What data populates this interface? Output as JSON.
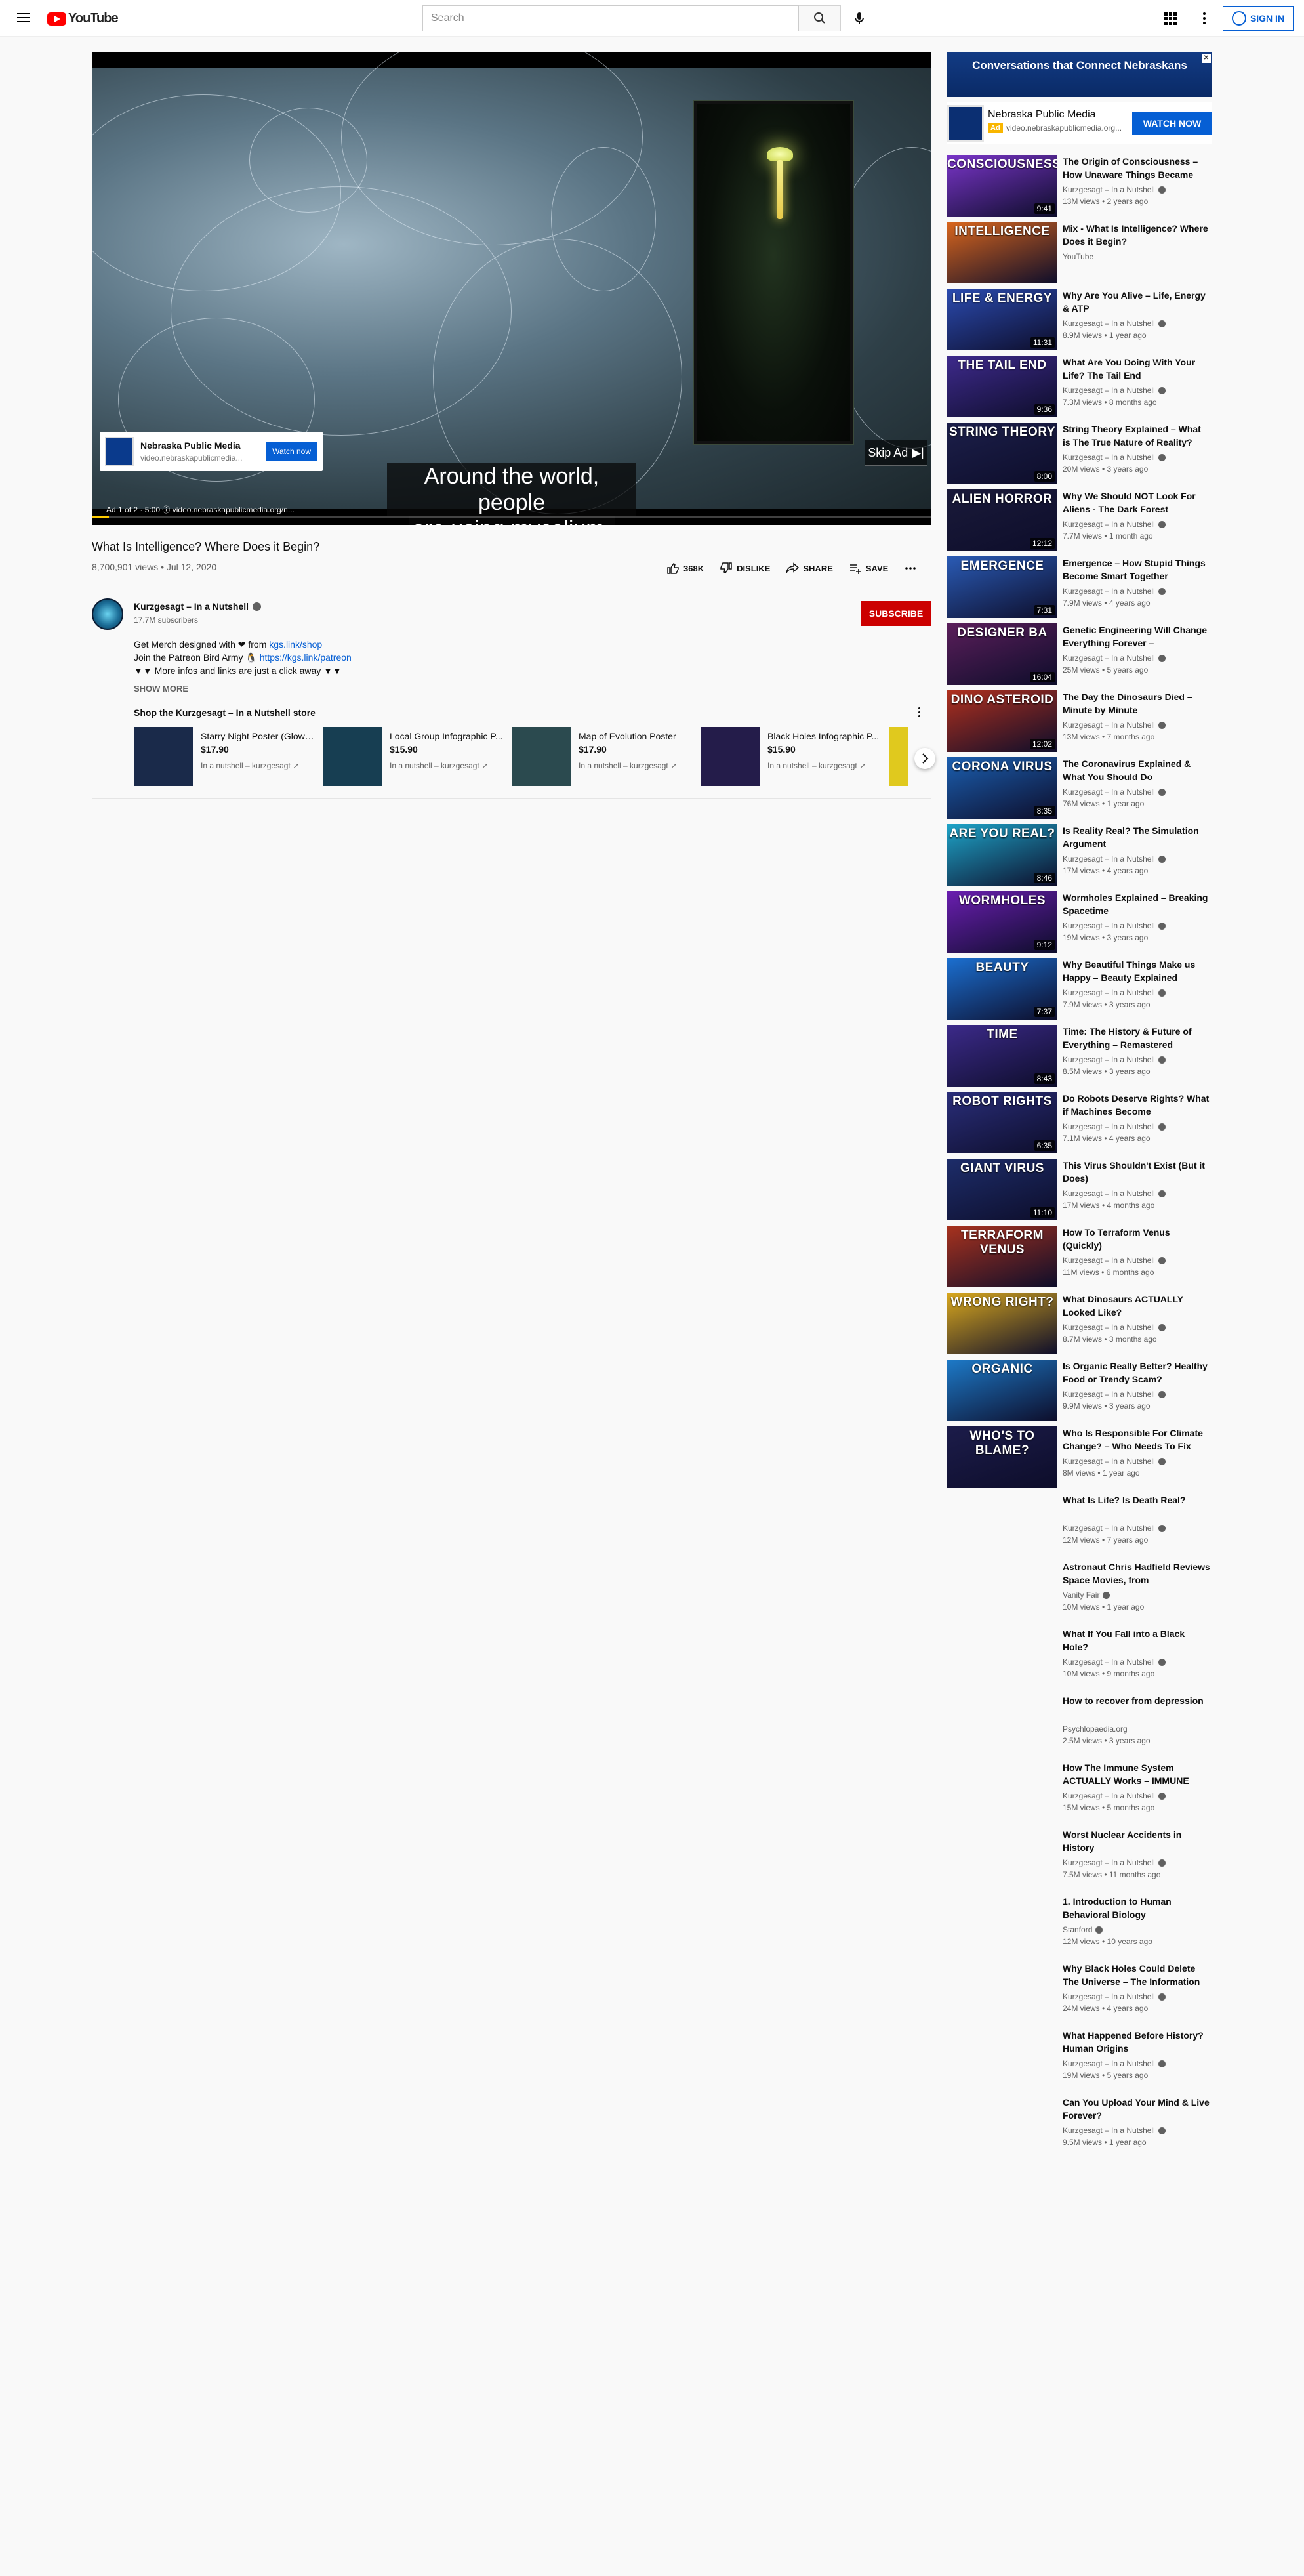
{
  "header": {
    "logo_text": "YouTube",
    "search_placeholder": "Search",
    "signin_label": "SIGN IN"
  },
  "player": {
    "subtitle_line1": "Around the world, people",
    "subtitle_line2": "are using mycelium,",
    "ad_card": {
      "name": "Nebraska Public Media",
      "url": "video.nebraskapublicmedia...",
      "button": "Watch now"
    },
    "skip_label": "Skip Ad",
    "ad_info": "Ad 1 of 2 · 5:00  ⓘ  video.nebraskapublicmedia.org/n...",
    "ad_progress": 0.02
  },
  "video": {
    "title": "What Is Intelligence? Where Does it Begin?",
    "meta": "8,700,901 views • Jul 12, 2020",
    "likes": "368K",
    "dislike_label": "DISLIKE",
    "share_label": "SHARE",
    "save_label": "SAVE"
  },
  "channel": {
    "name": "Kurzgesagt – In a Nutshell",
    "subscribers": "17.7M subscribers",
    "subscribe_label": "SUBSCRIBE"
  },
  "description": {
    "line1_text": "Get Merch designed with ❤ from ",
    "line1_link": "kgs.link/shop",
    "line2_text": "Join the Patreon Bird Army 🐧 ",
    "line2_link": "https://kgs.link/patreon",
    "line3_text": "▼▼ More infos and links are just a click away ▼▼",
    "show_more": "SHOW MORE"
  },
  "shop": {
    "title": "Shop the Kurzgesagt – In a Nutshell store",
    "products": [
      {
        "name": "Starry Night Poster (Glow i...",
        "price": "$17.90",
        "seller": "In a nutshell – kurzgesagt",
        "color": "#1a2a4a"
      },
      {
        "name": "Local Group Infographic P...",
        "price": "$15.90",
        "seller": "In a nutshell – kurzgesagt",
        "color": "#173e52"
      },
      {
        "name": "Map of Evolution Poster",
        "price": "$17.90",
        "seller": "In a nutshell – kurzgesagt",
        "color": "#2b4a4f"
      },
      {
        "name": "Black Holes Infographic P...",
        "price": "$15.90",
        "seller": "In a nutshell – kurzgesagt",
        "color": "#241c4a"
      }
    ]
  },
  "sidebar": {
    "ad_banner": "Conversations that Connect Nebraskans",
    "ad_name": "Nebraska Public Media",
    "ad_badge": "Ad",
    "ad_url": "video.nebraskapublicmedia.org...",
    "ad_button": "WATCH NOW",
    "recommendations": [
      {
        "title": "The Origin of Consciousness – How Unaware Things Became",
        "channel": "Kurzgesagt – In a Nutshell",
        "views": "13M views • 2 years ago",
        "thumb_text": "CONSCIOUSNESS",
        "duration": "9:41",
        "color": "#7a35c9",
        "verified": true
      },
      {
        "title": "Mix - What Is Intelligence? Where Does it Begin?",
        "channel": "YouTube",
        "views": "",
        "thumb_text": "INTELLIGENCE",
        "duration": "",
        "color": "#d9661d",
        "verified": false
      },
      {
        "title": "Why Are You Alive – Life, Energy & ATP",
        "channel": "Kurzgesagt – In a Nutshell",
        "views": "8.9M views • 1 year ago",
        "thumb_text": "LIFE & ENERGY",
        "duration": "11:31",
        "color": "#2b4bb0",
        "verified": true
      },
      {
        "title": "What Are You Doing With Your Life? The Tail End",
        "channel": "Kurzgesagt – In a Nutshell",
        "views": "7.3M views • 8 months ago",
        "thumb_text": "THE TAIL END",
        "duration": "9:36",
        "color": "#3e2a8c",
        "verified": true
      },
      {
        "title": "String Theory Explained – What is The True Nature of Reality?",
        "channel": "Kurzgesagt – In a Nutshell",
        "views": "20M views • 3 years ago",
        "thumb_text": "STRING THEORY",
        "duration": "8:00",
        "color": "#1c1f4a",
        "verified": true
      },
      {
        "title": "Why We Should NOT Look For Aliens - The Dark Forest",
        "channel": "Kurzgesagt – In a Nutshell",
        "views": "7.7M views • 1 month ago",
        "thumb_text": "ALIEN HORROR",
        "duration": "12:12",
        "color": "#1a1a3a",
        "verified": true
      },
      {
        "title": "Emergence – How Stupid Things Become Smart Together",
        "channel": "Kurzgesagt – In a Nutshell",
        "views": "7.9M views • 4 years ago",
        "thumb_text": "EMERGENCE",
        "duration": "7:31",
        "color": "#2a5bb5",
        "verified": true
      },
      {
        "title": "Genetic Engineering Will Change Everything Forever –",
        "channel": "Kurzgesagt – In a Nutshell",
        "views": "25M views • 5 years ago",
        "thumb_text": "DESIGNER BA",
        "duration": "16:04",
        "color": "#5a1e5a",
        "verified": true
      },
      {
        "title": "The Day the Dinosaurs Died – Minute by Minute",
        "channel": "Kurzgesagt – In a Nutshell",
        "views": "13M views • 7 months ago",
        "thumb_text": "DINO ASTEROID",
        "duration": "12:02",
        "color": "#b0301e",
        "verified": true
      },
      {
        "title": "The Coronavirus Explained & What You Should Do",
        "channel": "Kurzgesagt – In a Nutshell",
        "views": "76M views • 1 year ago",
        "thumb_text": "CORONA VIRUS",
        "duration": "8:35",
        "color": "#1b5fb0",
        "verified": true
      },
      {
        "title": "Is Reality Real? The Simulation Argument",
        "channel": "Kurzgesagt – In a Nutshell",
        "views": "17M views • 4 years ago",
        "thumb_text": "ARE YOU REAL?",
        "duration": "8:46",
        "color": "#1ea4c8",
        "verified": true
      },
      {
        "title": "Wormholes Explained – Breaking Spacetime",
        "channel": "Kurzgesagt – In a Nutshell",
        "views": "19M views • 3 years ago",
        "thumb_text": "WORMHOLES",
        "duration": "9:12",
        "color": "#6a1eb0",
        "verified": true
      },
      {
        "title": "Why Beautiful Things Make us Happy – Beauty Explained",
        "channel": "Kurzgesagt – In a Nutshell",
        "views": "7.9M views • 3 years ago",
        "thumb_text": "BEAUTY",
        "duration": "7:37",
        "color": "#1b6fd0",
        "verified": true
      },
      {
        "title": "Time: The History & Future of Everything – Remastered",
        "channel": "Kurzgesagt – In a Nutshell",
        "views": "8.5M views • 3 years ago",
        "thumb_text": "TIME",
        "duration": "8:43",
        "color": "#3c2a8a",
        "verified": true
      },
      {
        "title": "Do Robots Deserve Rights? What if Machines Become",
        "channel": "Kurzgesagt – In a Nutshell",
        "views": "7.1M views • 4 years ago",
        "thumb_text": "ROBOT RIGHTS",
        "duration": "6:35",
        "color": "#2a2e7a",
        "verified": true
      },
      {
        "title": "This Virus Shouldn't Exist (But it Does)",
        "channel": "Kurzgesagt – In a Nutshell",
        "views": "17M views • 4 months ago",
        "thumb_text": "GIANT VIRUS",
        "duration": "11:10",
        "color": "#1d2d6a",
        "verified": true
      },
      {
        "title": "How To Terraform Venus (Quickly)",
        "channel": "Kurzgesagt – In a Nutshell",
        "views": "11M views • 6 months ago",
        "thumb_text": "TERRAFORM VENUS",
        "duration": "",
        "color": "#a8321e",
        "verified": true
      },
      {
        "title": "What Dinosaurs ACTUALLY Looked Like?",
        "channel": "Kurzgesagt – In a Nutshell",
        "views": "8.7M views • 3 months ago",
        "thumb_text": "WRONG  RIGHT?",
        "duration": "",
        "color": "#d9a81e",
        "verified": true
      },
      {
        "title": "Is Organic Really Better? Healthy Food or Trendy Scam?",
        "channel": "Kurzgesagt – In a Nutshell",
        "views": "9.9M views • 3 years ago",
        "thumb_text": "ORGANIC",
        "duration": "",
        "color": "#1d7ac8",
        "verified": true
      },
      {
        "title": "Who Is Responsible For Climate Change? – Who Needs To Fix",
        "channel": "Kurzgesagt – In a Nutshell",
        "views": "8M views • 1 year ago",
        "thumb_text": "WHO'S TO BLAME?",
        "duration": "",
        "color": "#1c1c4a",
        "verified": true
      },
      {
        "title": "What Is Life? Is Death Real?",
        "channel": "Kurzgesagt – In a Nutshell",
        "views": "12M views • 7 years ago",
        "thumb_text": "",
        "duration": "",
        "color": "",
        "verified": true
      },
      {
        "title": "Astronaut Chris Hadfield Reviews Space Movies, from",
        "channel": "Vanity Fair",
        "views": "10M views • 1 year ago",
        "thumb_text": "",
        "duration": "",
        "color": "",
        "verified": true
      },
      {
        "title": "What If You Fall into a Black Hole?",
        "channel": "Kurzgesagt – In a Nutshell",
        "views": "10M views • 9 months ago",
        "thumb_text": "",
        "duration": "",
        "color": "",
        "verified": true
      },
      {
        "title": "How to recover from depression",
        "channel": "Psychlopaedia.org",
        "views": "2.5M views • 3 years ago",
        "thumb_text": "",
        "duration": "",
        "color": "",
        "verified": false
      },
      {
        "title": "How The Immune System ACTUALLY Works – IMMUNE",
        "channel": "Kurzgesagt – In a Nutshell",
        "views": "15M views • 5 months ago",
        "thumb_text": "",
        "duration": "",
        "color": "",
        "verified": true
      },
      {
        "title": "Worst Nuclear Accidents in History",
        "channel": "Kurzgesagt – In a Nutshell",
        "views": "7.5M views • 11 months ago",
        "thumb_text": "",
        "duration": "",
        "color": "",
        "verified": true
      },
      {
        "title": "1. Introduction to Human Behavioral Biology",
        "channel": "Stanford",
        "views": "12M views • 10 years ago",
        "thumb_text": "",
        "duration": "",
        "color": "",
        "verified": true
      },
      {
        "title": "Why Black Holes Could Delete The Universe – The Information",
        "channel": "Kurzgesagt – In a Nutshell",
        "views": "24M views • 4 years ago",
        "thumb_text": "",
        "duration": "",
        "color": "",
        "verified": true
      },
      {
        "title": "What Happened Before History? Human Origins",
        "channel": "Kurzgesagt – In a Nutshell",
        "views": "19M views • 5 years ago",
        "thumb_text": "",
        "duration": "",
        "color": "",
        "verified": true
      },
      {
        "title": "Can You Upload Your Mind & Live Forever?",
        "channel": "Kurzgesagt – In a Nutshell",
        "views": "9.5M views • 1 year ago",
        "thumb_text": "",
        "duration": "",
        "color": "",
        "verified": true
      }
    ]
  }
}
